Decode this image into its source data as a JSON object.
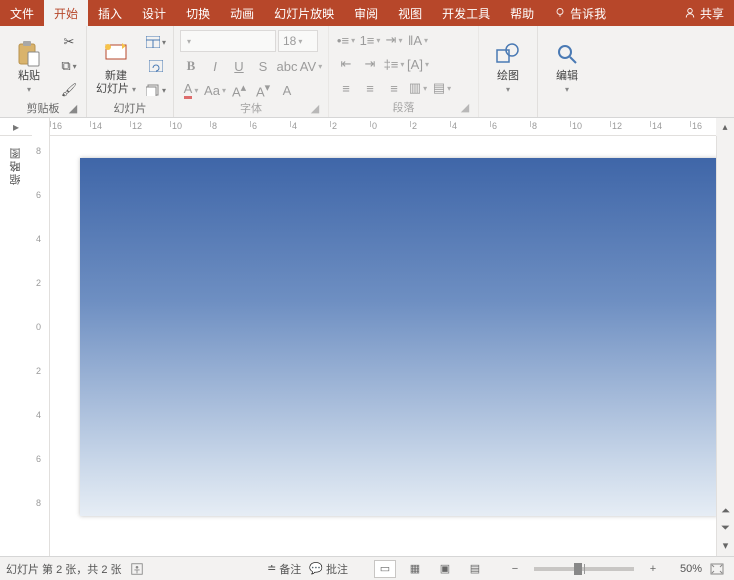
{
  "tabs": {
    "file": "文件",
    "home": "开始",
    "insert": "插入",
    "design": "设计",
    "transitions": "切换",
    "animations": "动画",
    "slideshow": "幻灯片放映",
    "review": "审阅",
    "view": "视图",
    "developer": "开发工具",
    "help": "帮助",
    "tellme": "告诉我",
    "share": "共享"
  },
  "ribbon": {
    "clipboard": {
      "paste": "粘贴",
      "label": "剪贴板"
    },
    "slides": {
      "newslide_l1": "新建",
      "newslide_l2": "幻灯片",
      "label": "幻灯片"
    },
    "font": {
      "size": "18",
      "label": "字体",
      "bold": "B",
      "italic": "I",
      "underline": "U",
      "strike": "S",
      "clear": "A"
    },
    "para": {
      "label": "段落"
    },
    "drawing": {
      "btn": "绘图",
      "label": ""
    },
    "editing": {
      "btn": "编辑",
      "label": ""
    }
  },
  "rulerH": [
    "16",
    "14",
    "12",
    "10",
    "8",
    "6",
    "4",
    "2",
    "0",
    "2",
    "4",
    "6",
    "8",
    "10",
    "12",
    "14",
    "16"
  ],
  "rulerV": [
    "8",
    "6",
    "4",
    "2",
    "0",
    "2",
    "4",
    "6",
    "8"
  ],
  "left": {
    "outline": "缩略图"
  },
  "status": {
    "slide_info": "幻灯片 第 2 张，共 2 张",
    "notes": "备注",
    "comments": "批注",
    "zoom": "50%"
  }
}
